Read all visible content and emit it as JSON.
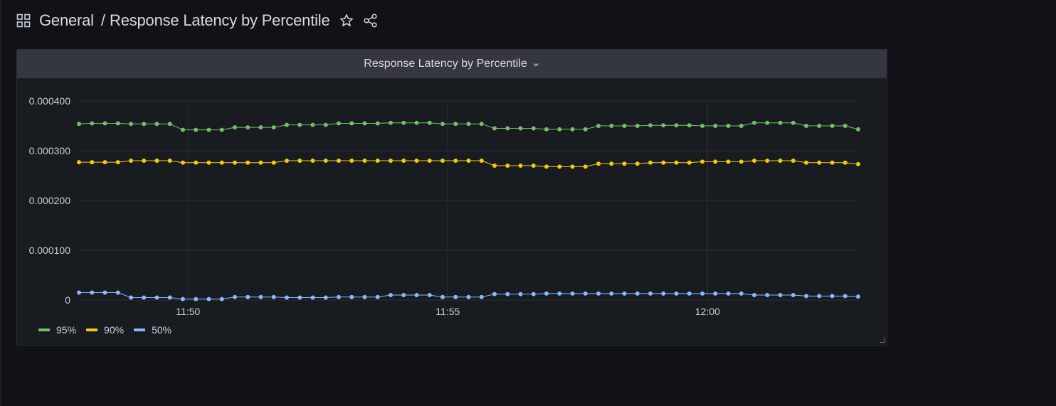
{
  "breadcrumb": {
    "folder": "General",
    "separator": "/",
    "dashboard": "Response Latency by Percentile"
  },
  "panel": {
    "title": "Response Latency by Percentile"
  },
  "icons": {
    "dashboards": "apps-grid-icon",
    "star": "star-icon",
    "share": "share-icon",
    "panel_menu": "chevron-down-icon",
    "resize": "resize-handle-icon"
  },
  "colors": {
    "background": "#111217",
    "panel": "#181b1f",
    "panel_header": "#34373d",
    "p95": "#73bf69",
    "p90": "#f2cc0c",
    "p50": "#8ab8ff"
  },
  "chart_data": {
    "type": "line",
    "ylim": [
      0,
      0.0004
    ],
    "yticks": [
      {
        "value": 0.0004,
        "label": "0.000400"
      },
      {
        "value": 0.0003,
        "label": "0.000300"
      },
      {
        "value": 0.0002,
        "label": "0.000200"
      },
      {
        "value": 0.0001,
        "label": "0.000100"
      },
      {
        "value": 0,
        "label": "0"
      }
    ],
    "xlim": [
      0,
      60
    ],
    "xticks": [
      {
        "value": 8.4,
        "label": "11:50"
      },
      {
        "value": 28.4,
        "label": "11:55"
      },
      {
        "value": 48.4,
        "label": "12:00"
      }
    ],
    "grid": true,
    "legend": "bottom-left",
    "series": [
      {
        "name": "95%",
        "color": "#73bf69",
        "values": [
          0.000354,
          0.000355,
          0.000355,
          0.000355,
          0.000354,
          0.000354,
          0.000354,
          0.000354,
          0.000342,
          0.000342,
          0.000342,
          0.000342,
          0.000347,
          0.000347,
          0.000347,
          0.000347,
          0.000352,
          0.000352,
          0.000352,
          0.000352,
          0.000355,
          0.000355,
          0.000355,
          0.000355,
          0.000356,
          0.000356,
          0.000356,
          0.000356,
          0.000354,
          0.000354,
          0.000354,
          0.000354,
          0.000345,
          0.000345,
          0.000345,
          0.000345,
          0.000343,
          0.000343,
          0.000343,
          0.000343,
          0.00035,
          0.00035,
          0.00035,
          0.00035,
          0.000351,
          0.000351,
          0.000351,
          0.000351,
          0.00035,
          0.00035,
          0.00035,
          0.00035,
          0.000356,
          0.000356,
          0.000356,
          0.000356,
          0.00035,
          0.00035,
          0.00035,
          0.00035,
          0.000343
        ]
      },
      {
        "name": "90%",
        "color": "#f2cc0c",
        "values": [
          0.000277,
          0.000277,
          0.000277,
          0.000277,
          0.00028,
          0.00028,
          0.00028,
          0.00028,
          0.000276,
          0.000276,
          0.000276,
          0.000276,
          0.000276,
          0.000276,
          0.000276,
          0.000276,
          0.00028,
          0.00028,
          0.00028,
          0.00028,
          0.00028,
          0.00028,
          0.00028,
          0.00028,
          0.00028,
          0.00028,
          0.00028,
          0.00028,
          0.00028,
          0.00028,
          0.00028,
          0.00028,
          0.00027,
          0.00027,
          0.00027,
          0.00027,
          0.000268,
          0.000268,
          0.000268,
          0.000268,
          0.000274,
          0.000274,
          0.000274,
          0.000274,
          0.000276,
          0.000276,
          0.000276,
          0.000276,
          0.000278,
          0.000278,
          0.000278,
          0.000278,
          0.00028,
          0.00028,
          0.00028,
          0.00028,
          0.000276,
          0.000276,
          0.000276,
          0.000276,
          0.000273
        ]
      },
      {
        "name": "50%",
        "color": "#8ab8ff",
        "values": [
          1.5e-05,
          1.5e-05,
          1.5e-05,
          1.5e-05,
          5e-06,
          5e-06,
          5e-06,
          5e-06,
          2e-06,
          2e-06,
          2e-06,
          2e-06,
          6e-06,
          6e-06,
          6e-06,
          6e-06,
          5e-06,
          5e-06,
          5e-06,
          5e-06,
          6e-06,
          6e-06,
          6e-06,
          6e-06,
          1e-05,
          1e-05,
          1e-05,
          1e-05,
          6e-06,
          6e-06,
          6e-06,
          6e-06,
          1.2e-05,
          1.2e-05,
          1.2e-05,
          1.2e-05,
          1.3e-05,
          1.3e-05,
          1.3e-05,
          1.3e-05,
          1.3e-05,
          1.3e-05,
          1.3e-05,
          1.3e-05,
          1.3e-05,
          1.3e-05,
          1.3e-05,
          1.3e-05,
          1.3e-05,
          1.3e-05,
          1.3e-05,
          1.3e-05,
          1e-05,
          1e-05,
          1e-05,
          1e-05,
          8e-06,
          8e-06,
          8e-06,
          8e-06,
          7e-06
        ]
      }
    ]
  }
}
